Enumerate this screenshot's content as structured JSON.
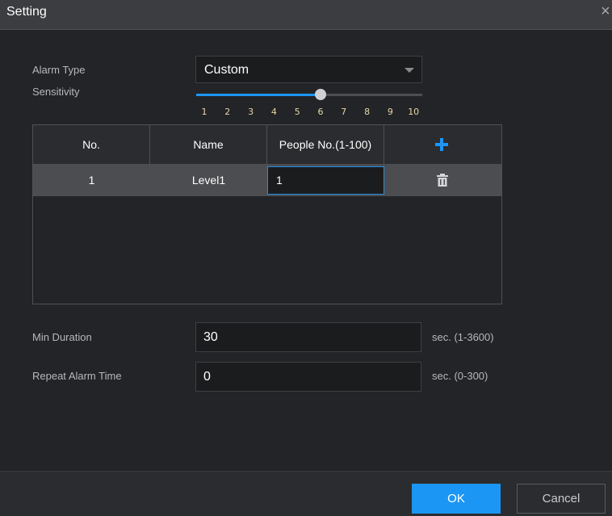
{
  "dialog": {
    "title": "Setting",
    "close_glyph": "×"
  },
  "alarm_type": {
    "label": "Alarm Type",
    "value": "Custom"
  },
  "sensitivity": {
    "label": "Sensitivity",
    "value": 6,
    "min": 1,
    "max": 10,
    "ticks": [
      "1",
      "2",
      "3",
      "4",
      "5",
      "6",
      "7",
      "8",
      "9",
      "10"
    ],
    "accent": "#1c96f5"
  },
  "table": {
    "headers": {
      "no": "No.",
      "name": "Name",
      "people": "People No.(1-100)"
    },
    "add_icon": "plus-icon",
    "rows": [
      {
        "no": "1",
        "name": "Level1",
        "people": "1",
        "action_icon": "trash-icon"
      }
    ]
  },
  "min_duration": {
    "label": "Min Duration",
    "value": "30",
    "unit": "sec. (1-3600)"
  },
  "repeat_alarm": {
    "label": "Repeat Alarm Time",
    "value": "0",
    "unit": "sec. (0-300)"
  },
  "buttons": {
    "ok": "OK",
    "cancel": "Cancel"
  },
  "colors": {
    "accent": "#1c96f5",
    "background": "#232427",
    "row_highlight": "#4c4d50"
  }
}
